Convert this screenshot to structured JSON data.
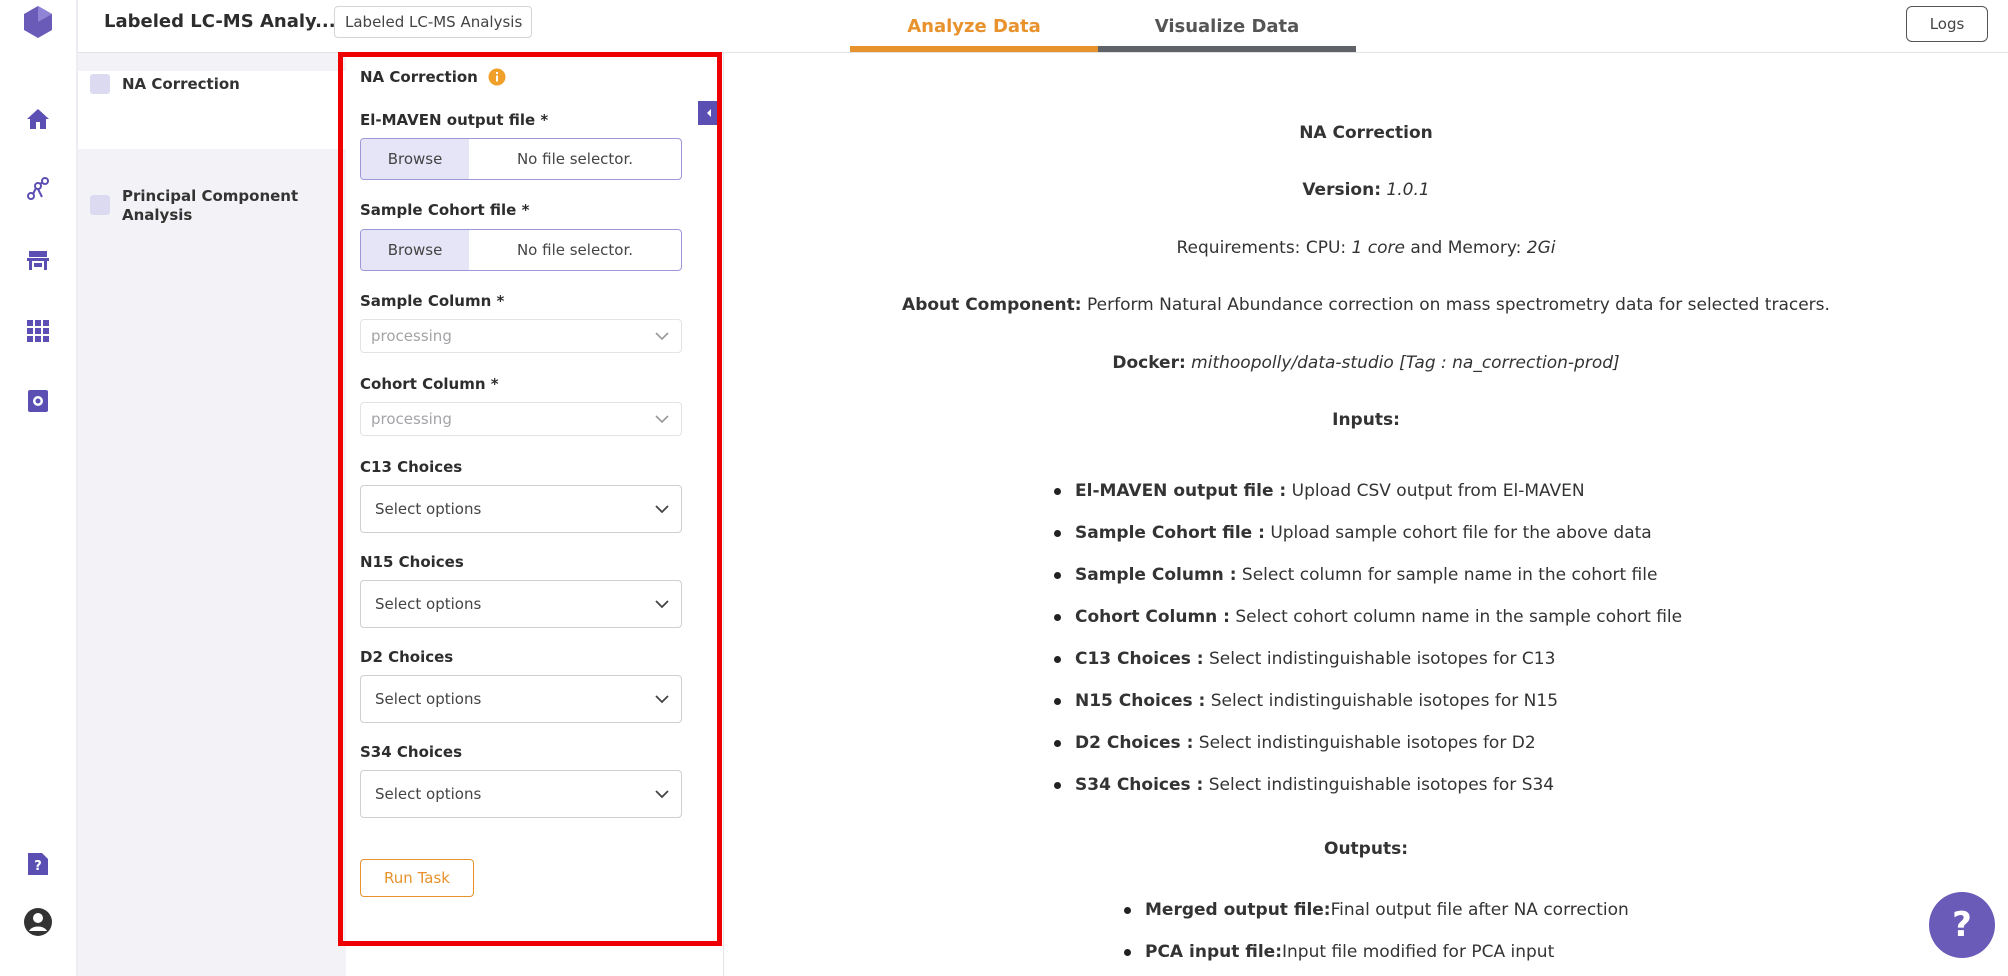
{
  "header": {
    "project_title": "Labeled LC-MS Analy...",
    "project_input_value": "Labeled LC-MS Analysis",
    "tabs": [
      {
        "label": "Analyze Data",
        "active": true
      },
      {
        "label": "Visualize Data",
        "active": false
      }
    ],
    "logs_label": "Logs",
    "accent_color": "#e8922d"
  },
  "sidebar": {
    "icons": [
      "logo-icon",
      "home-icon",
      "workflow-icon",
      "lab-icon",
      "apps-grid-icon",
      "data-icon",
      "help-doc-icon",
      "user-avatar-icon"
    ]
  },
  "components": {
    "items": [
      {
        "label": "NA Correction",
        "selected": true
      },
      {
        "label": "Principal Component Analysis",
        "selected": false
      }
    ]
  },
  "form": {
    "heading": "NA Correction",
    "elmaven_label": "El-MAVEN output file *",
    "cohort_file_label": "Sample Cohort file *",
    "browse_label": "Browse",
    "no_file_text": "No file selector.",
    "sample_column_label": "Sample Column *",
    "cohort_column_label": "Cohort Column *",
    "processing_text": "processing",
    "c13_label": "C13 Choices",
    "n15_label": "N15 Choices",
    "d2_label": "D2 Choices",
    "s34_label": "S34 Choices",
    "select_placeholder": "Select options",
    "run_label": "Run Task"
  },
  "info": {
    "title": "NA Correction",
    "version_label": "Version:",
    "version_value": "1.0.1",
    "req_prefix": "Requirements: CPU:",
    "cpu_value": "1 core",
    "req_mid": "and Memory:",
    "mem_value": "2Gi",
    "about_label": "About Component:",
    "about_text": "Perform Natural Abundance correction on mass spectrometry data for selected tracers.",
    "docker_label": "Docker:",
    "docker_value": "mithoopolly/data-studio [Tag : na_correction-prod]",
    "inputs_heading": "Inputs:",
    "inputs": [
      {
        "name": "El-MAVEN output file :",
        "desc": "Upload CSV output from El-MAVEN"
      },
      {
        "name": "Sample Cohort file :",
        "desc": "Upload sample cohort file for the above data"
      },
      {
        "name": "Sample Column :",
        "desc": "Select column for sample name in the cohort file"
      },
      {
        "name": "Cohort Column :",
        "desc": "Select cohort column name in the sample cohort file"
      },
      {
        "name": "C13 Choices :",
        "desc": "Select indistinguishable isotopes for C13"
      },
      {
        "name": "N15 Choices :",
        "desc": "Select indistinguishable isotopes for N15"
      },
      {
        "name": "D2 Choices :",
        "desc": "Select indistinguishable isotopes for D2"
      },
      {
        "name": "S34 Choices :",
        "desc": "Select indistinguishable isotopes for S34"
      }
    ],
    "outputs_heading": "Outputs:",
    "outputs": [
      {
        "name": "Merged output file:",
        "desc": "Final output file after NA correction"
      },
      {
        "name": "PCA input file:",
        "desc": "Input file modified for PCA input"
      }
    ]
  },
  "help_button_label": "?"
}
